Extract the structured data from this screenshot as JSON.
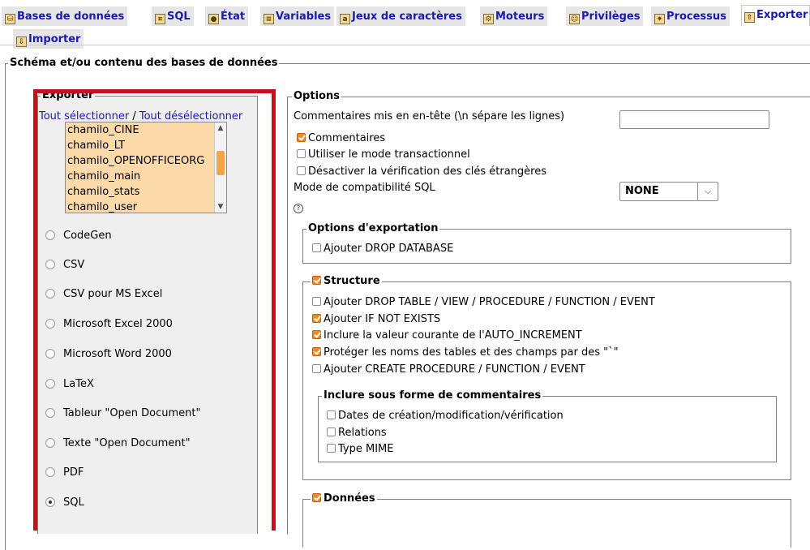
{
  "tabs": [
    {
      "label": "Bases de données",
      "icon": "databases-icon",
      "glyph": "⛁"
    },
    {
      "label": "SQL",
      "icon": "sql-icon",
      "glyph": "⌗"
    },
    {
      "label": "État",
      "icon": "status-icon",
      "glyph": "●"
    },
    {
      "label": "Variables",
      "icon": "variables-icon",
      "glyph": "≡"
    },
    {
      "label": "Jeux de caractères",
      "icon": "charsets-icon",
      "glyph": "a"
    },
    {
      "label": "Moteurs",
      "icon": "engines-icon",
      "glyph": "⚙"
    },
    {
      "label": "Privilèges",
      "icon": "privileges-icon",
      "glyph": "☺"
    },
    {
      "label": "Processus",
      "icon": "processes-icon",
      "glyph": "✷"
    },
    {
      "label": "Exporter",
      "icon": "export-icon",
      "glyph": "⇧"
    },
    {
      "label": "Importer",
      "icon": "import-icon",
      "glyph": "⇩"
    }
  ],
  "main_legend": "Schéma et/ou contenu des bases de données",
  "export": {
    "legend": "Exporter",
    "select_all": "Tout sélectionner",
    "separator": "/",
    "deselect_all": "Tout désélectionner",
    "databases": [
      "chamilo_CINE",
      "chamilo_LT",
      "chamilo_OPENOFFICEORG",
      "chamilo_main",
      "chamilo_stats",
      "chamilo_user"
    ],
    "formats": [
      {
        "label": "CodeGen",
        "selected": false
      },
      {
        "label": "CSV",
        "selected": false
      },
      {
        "label": "CSV pour MS Excel",
        "selected": false
      },
      {
        "label": "Microsoft Excel 2000",
        "selected": false
      },
      {
        "label": "Microsoft Word 2000",
        "selected": false
      },
      {
        "label": "LaTeX",
        "selected": false
      },
      {
        "label": "Tableur \"Open Document\"",
        "selected": false
      },
      {
        "label": "Texte \"Open Document\"",
        "selected": false
      },
      {
        "label": "PDF",
        "selected": false
      },
      {
        "label": "SQL",
        "selected": true
      }
    ]
  },
  "options": {
    "legend": "Options",
    "header_comment_label": "Commentaires mis en en-tête (\\n sépare les lignes)",
    "header_comment_value": "",
    "comments": {
      "label": "Commentaires",
      "checked": true
    },
    "transactional": {
      "label": "Utiliser le mode transactionnel",
      "checked": false
    },
    "disable_fk": {
      "label": "Désactiver la vérification des clés étrangères",
      "checked": false
    },
    "compat_label": "Mode de compatibilité SQL",
    "compat_value": "NONE",
    "export_options": {
      "legend": "Options d'exportation",
      "drop_database": {
        "label": "Ajouter DROP DATABASE",
        "checked": false
      }
    },
    "structure": {
      "legend": "Structure",
      "checked": true,
      "items": [
        {
          "label": "Ajouter DROP TABLE / VIEW / PROCEDURE / FUNCTION / EVENT",
          "checked": false
        },
        {
          "label": "Ajouter IF NOT EXISTS",
          "checked": true
        },
        {
          "label": "Inclure la valeur courante de l'AUTO_INCREMENT",
          "checked": true
        },
        {
          "label": "Protéger les noms des tables et des champs par des \"`\"",
          "checked": true
        },
        {
          "label": "Ajouter CREATE PROCEDURE / FUNCTION / EVENT",
          "checked": false
        }
      ],
      "comments_block": {
        "legend": "Inclure sous forme de commentaires",
        "items": [
          {
            "label": "Dates de création/modification/vérification",
            "checked": false
          },
          {
            "label": "Relations",
            "checked": false
          },
          {
            "label": "Type MIME",
            "checked": false
          }
        ]
      }
    },
    "data": {
      "legend": "Données",
      "checked": true
    }
  }
}
